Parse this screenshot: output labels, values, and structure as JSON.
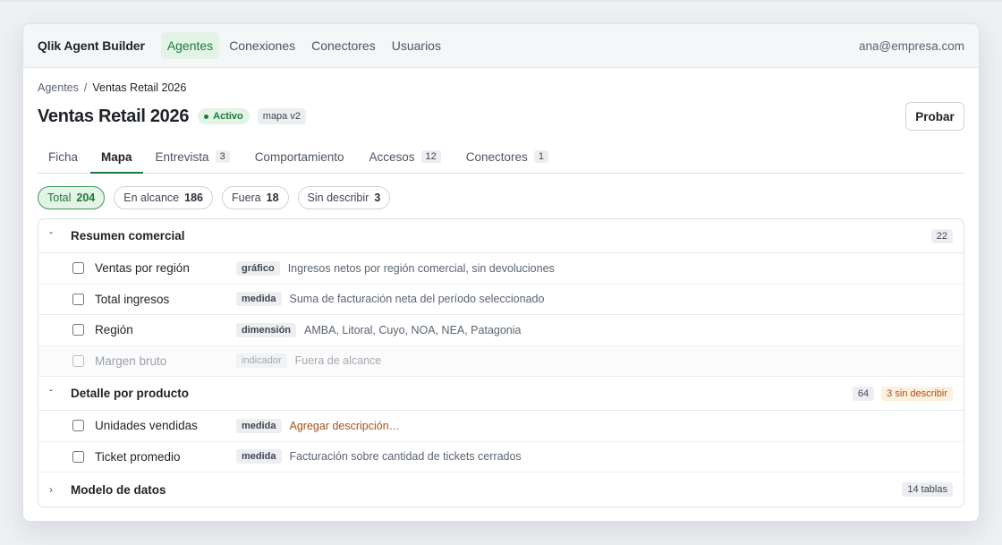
{
  "app": {
    "name": "Qlik Agent Builder"
  },
  "nav": {
    "items": [
      {
        "label": "Agentes",
        "active": true
      },
      {
        "label": "Conexiones",
        "active": false
      },
      {
        "label": "Conectores",
        "active": false
      },
      {
        "label": "Usuarios",
        "active": false
      }
    ],
    "user": "ana@empresa.com"
  },
  "breadcrumb": {
    "root": "Agentes",
    "separator": "/",
    "current": "Ventas Retail 2026"
  },
  "agent": {
    "title": "Ventas Retail 2026",
    "status": "Activo",
    "version": "mapa v2",
    "try_label": "Probar"
  },
  "tabs": [
    {
      "label": "Ficha",
      "count": "",
      "active": false
    },
    {
      "label": "Mapa",
      "count": "",
      "active": true
    },
    {
      "label": "Entrevista",
      "count": "3",
      "active": false
    },
    {
      "label": "Comportamiento",
      "count": "",
      "active": false
    },
    {
      "label": "Accesos",
      "count": "12",
      "active": false
    },
    {
      "label": "Conectores",
      "count": "1",
      "active": false
    }
  ],
  "filters": [
    {
      "label": "Total",
      "count": "204",
      "active": true
    },
    {
      "label": "En alcance",
      "count": "186",
      "active": false
    },
    {
      "label": "Fuera",
      "count": "18",
      "active": false
    },
    {
      "label": "Sin describir",
      "count": "3",
      "active": false
    }
  ],
  "groups": [
    {
      "title": "Resumen comercial",
      "expanded": true,
      "count": "22",
      "warning": "",
      "items": [
        {
          "name": "Ventas por región",
          "type": "gráfico",
          "description": "Ingresos netos por región comercial, sin devoluciones",
          "in_scope": true
        },
        {
          "name": "Total ingresos",
          "type": "medida",
          "description": "Suma de facturación neta del período seleccionado",
          "in_scope": true
        },
        {
          "name": "Región",
          "type": "dimensión",
          "description": "AMBA, Litoral, Cuyo, NOA, NEA, Patagonia",
          "in_scope": true
        },
        {
          "name": "Margen bruto",
          "type": "indicador",
          "description": "Fuera de alcance",
          "in_scope": false
        }
      ]
    },
    {
      "title": "Detalle por producto",
      "expanded": true,
      "count": "64",
      "warning": "3 sin describir",
      "items": [
        {
          "name": "Unidades vendidas",
          "type": "medida",
          "description": "Agregar descripción…",
          "in_scope": true,
          "missing": true
        },
        {
          "name": "Ticket promedio",
          "type": "medida",
          "description": "Facturación sobre cantidad de tickets cerrados",
          "in_scope": true
        }
      ]
    },
    {
      "title": "Modelo de datos",
      "expanded": false,
      "count": "14 tablas",
      "warning": ""
    }
  ],
  "icons": {
    "expanded": "chevron-down-icon",
    "collapsed": "chevron-right-icon",
    "status": "status-dot-icon"
  },
  "colors": {
    "accent": "#1b7a3a",
    "accent_bg": "#e3f3e6",
    "warning": "#a8501a",
    "warning_bg": "#fdf0de"
  }
}
